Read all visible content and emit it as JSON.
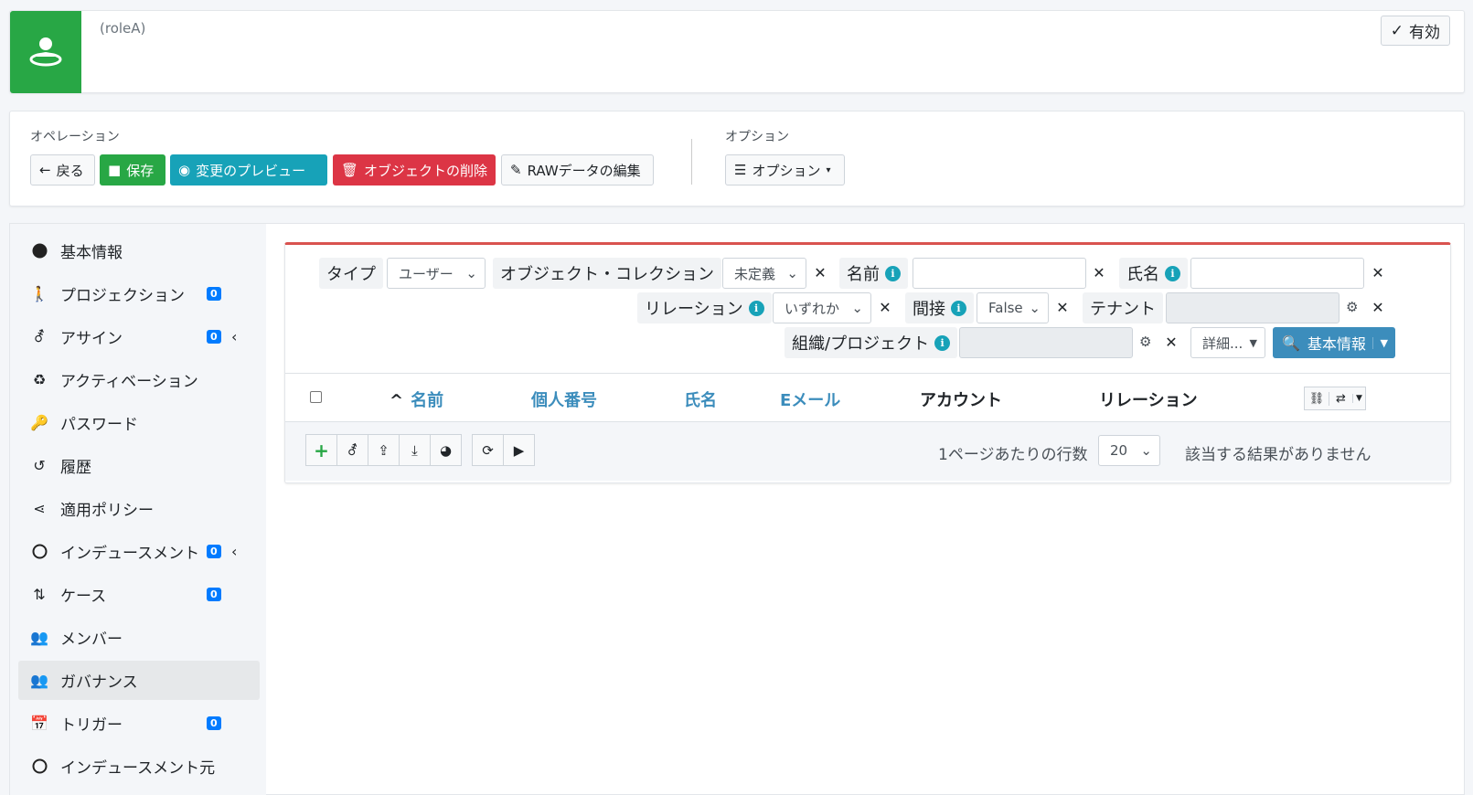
{
  "header": {
    "subtitle": "(roleA)",
    "status_label": "有効"
  },
  "operations": {
    "label": "オペレーション",
    "back": "戻る",
    "save": "保存",
    "preview": "変更のプレビュー",
    "delete": "オブジェクトの削除",
    "edit_raw": "RAWデータの編集"
  },
  "options": {
    "label": "オプション",
    "button": "オプション"
  },
  "sidebar": {
    "items": [
      {
        "label": "基本情報",
        "badge": null
      },
      {
        "label": "プロジェクション",
        "badge": "0"
      },
      {
        "label": "アサイン",
        "badge": "0"
      },
      {
        "label": "アクティベーション",
        "badge": null
      },
      {
        "label": "パスワード",
        "badge": null
      },
      {
        "label": "履歴",
        "badge": null
      },
      {
        "label": "適用ポリシー",
        "badge": null
      },
      {
        "label": "インデュースメント",
        "badge": "0"
      },
      {
        "label": "ケース",
        "badge": "0"
      },
      {
        "label": "メンバー",
        "badge": null
      },
      {
        "label": "ガバナンス",
        "badge": null
      },
      {
        "label": "トリガー",
        "badge": "0"
      },
      {
        "label": "インデュースメント元",
        "badge": null
      }
    ]
  },
  "filters": {
    "type_label": "タイプ",
    "type_value": "ユーザー",
    "collection_label": "オブジェクト・コレクション",
    "collection_value": "未定義",
    "name_label": "名前",
    "fullname_label": "氏名",
    "relation_label": "リレーション",
    "relation_value": "いずれか",
    "indirect_label": "間接",
    "indirect_value": "False",
    "tenant_label": "テナント",
    "org_label": "組織/プロジェクト",
    "more_value": "詳細...",
    "search_button": "基本情報"
  },
  "table": {
    "columns": [
      "名前",
      "個人番号",
      "氏名",
      "Eメール",
      "アカウント",
      "リレーション"
    ],
    "rows_per_page_label": "1ページあたりの行数",
    "rows_per_page_value": "20",
    "empty_message": "該当する結果がありません"
  }
}
